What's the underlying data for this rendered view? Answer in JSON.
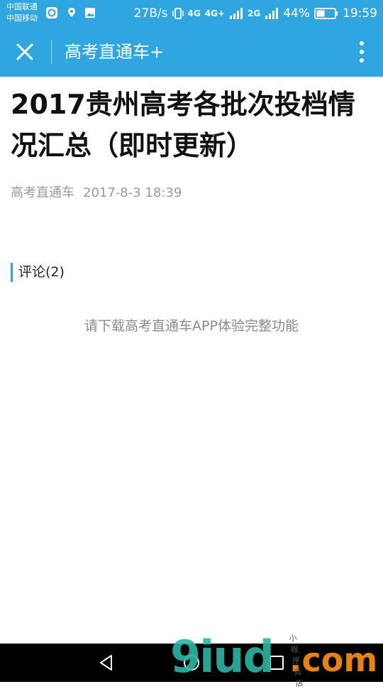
{
  "status_bar": {
    "carrier_1": "中国联通",
    "carrier_2": "中国移动",
    "net_speed": "27B/s",
    "net_4g": "4G",
    "net_4g_plus": "4G+",
    "net_2g": "2G",
    "battery": "44%",
    "time": "19:59"
  },
  "app_bar": {
    "title": "高考直通车+"
  },
  "article": {
    "title": "2017贵州高考各批次投档情况汇总（即时更新）",
    "source": "高考直通车",
    "date": "2017-8-3 18:39"
  },
  "comments": {
    "label": "评论(2)"
  },
  "download_prompt": "请下载高考直通车APP体验完整功能",
  "watermark": {
    "main": "9iud",
    "suffix": ".com",
    "tagline": "小程序商店"
  },
  "colors": {
    "header": "#2fa6e0",
    "accent": "#2fa6e0"
  }
}
